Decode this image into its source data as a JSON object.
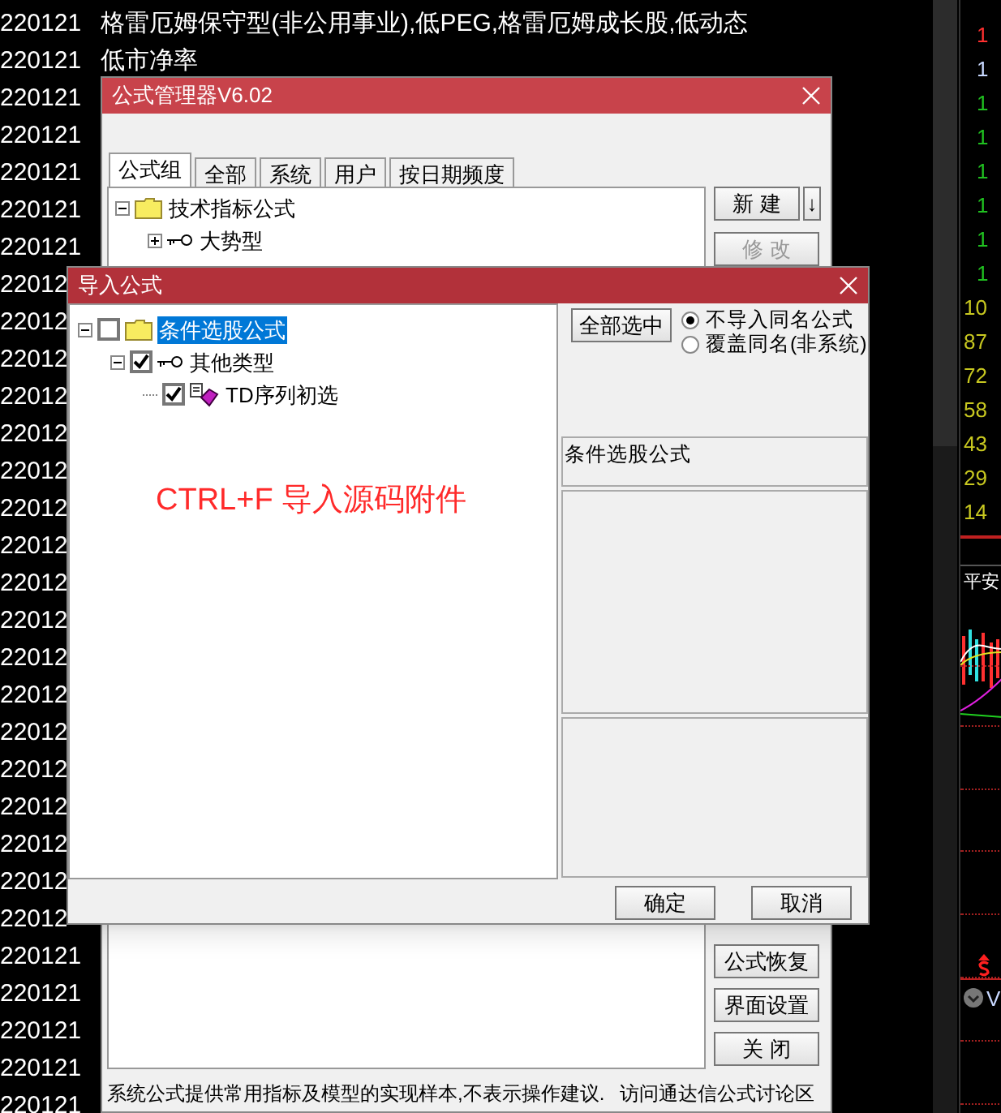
{
  "quote_list": [
    {
      "date": "220121",
      "names": "格雷厄姆保守型(非公用事业),低PEG,格雷厄姆成长股,低动态"
    },
    {
      "date": "220121",
      "names": "低市净率"
    },
    {
      "date": "220121"
    },
    {
      "date": "220121"
    },
    {
      "date": "220121"
    },
    {
      "date": "220121"
    },
    {
      "date": "220121"
    },
    {
      "date": "22012"
    },
    {
      "date": "22012"
    },
    {
      "date": "22012"
    },
    {
      "date": "22012"
    },
    {
      "date": "22012"
    },
    {
      "date": "22012"
    },
    {
      "date": "22012"
    },
    {
      "date": "22012"
    },
    {
      "date": "22012"
    },
    {
      "date": "22012"
    },
    {
      "date": "22012"
    },
    {
      "date": "22012"
    },
    {
      "date": "22012"
    },
    {
      "date": "22012"
    },
    {
      "date": "22012"
    },
    {
      "date": "22012"
    },
    {
      "date": "22012"
    },
    {
      "date": "22012"
    },
    {
      "date": "220121"
    },
    {
      "date": "220121"
    },
    {
      "date": "220121"
    },
    {
      "date": "220121"
    },
    {
      "date": "220121"
    }
  ],
  "side_panel": {
    "values": [
      {
        "text": "1",
        "color": "#ff3030"
      },
      {
        "text": "1",
        "color": "#c8d8ff"
      },
      {
        "text": "1",
        "color": "#20c020"
      },
      {
        "text": "1",
        "color": "#20c020"
      },
      {
        "text": "1",
        "color": "#20c020"
      },
      {
        "text": "1",
        "color": "#20c020"
      },
      {
        "text": "1",
        "color": "#20c020"
      },
      {
        "text": "1",
        "color": "#20c020"
      },
      {
        "text": "10",
        "color": "#c8c820"
      },
      {
        "text": "87",
        "color": "#c8c820"
      },
      {
        "text": "72",
        "color": "#c8c820"
      },
      {
        "text": "58",
        "color": "#c8c820"
      },
      {
        "text": "43",
        "color": "#c8c820"
      },
      {
        "text": "29",
        "color": "#c8c820"
      },
      {
        "text": "14",
        "color": "#c8c820"
      }
    ],
    "stock_label": "平安",
    "volume_label": "V"
  },
  "formula_manager": {
    "title": "公式管理器V6.02",
    "tabs": [
      {
        "label": "公式组",
        "selected": true
      },
      {
        "label": "全部",
        "selected": false
      },
      {
        "label": "系统",
        "selected": false
      },
      {
        "label": "用户",
        "selected": false
      },
      {
        "label": "按日期频度",
        "selected": false
      }
    ],
    "tree": [
      {
        "label": "技术指标公式",
        "kind": "folder",
        "expanded": true,
        "children": [
          {
            "label": "大势型",
            "kind": "category",
            "expanded": false
          }
        ]
      }
    ],
    "top_buttons": [
      {
        "label": "新 建",
        "disabled": false
      },
      {
        "label": "修 改",
        "disabled": true
      }
    ],
    "sort_button": "↓",
    "bottom_buttons": [
      {
        "label": "公式恢复",
        "disabled": false
      },
      {
        "label": "界面设置",
        "disabled": false
      },
      {
        "label": "关 闭",
        "disabled": false
      }
    ],
    "status_text": "系统公式提供常用指标及模型的实现样本,不表示操作建议.",
    "forum_link": "访问通达信公式讨论区"
  },
  "import_dialog": {
    "title": "导入公式",
    "tree": [
      {
        "label": "条件选股公式",
        "kind": "folder",
        "checked": false,
        "selected": true,
        "expanded": true,
        "children": [
          {
            "label": "其他类型",
            "kind": "category",
            "checked": true,
            "selected": false,
            "expanded": true,
            "children": [
              {
                "label": "TD序列初选",
                "kind": "formula",
                "checked": true,
                "selected": false
              }
            ]
          }
        ]
      }
    ],
    "annotation": "CTRL+F 导入源码附件",
    "select_all_button": "全部选中",
    "options": [
      {
        "label": "不导入同名公式",
        "selected": true
      },
      {
        "label": "覆盖同名(非系统)",
        "selected": false
      }
    ],
    "group_name": "条件选股公式",
    "buttons": [
      "确定",
      "取消"
    ]
  }
}
